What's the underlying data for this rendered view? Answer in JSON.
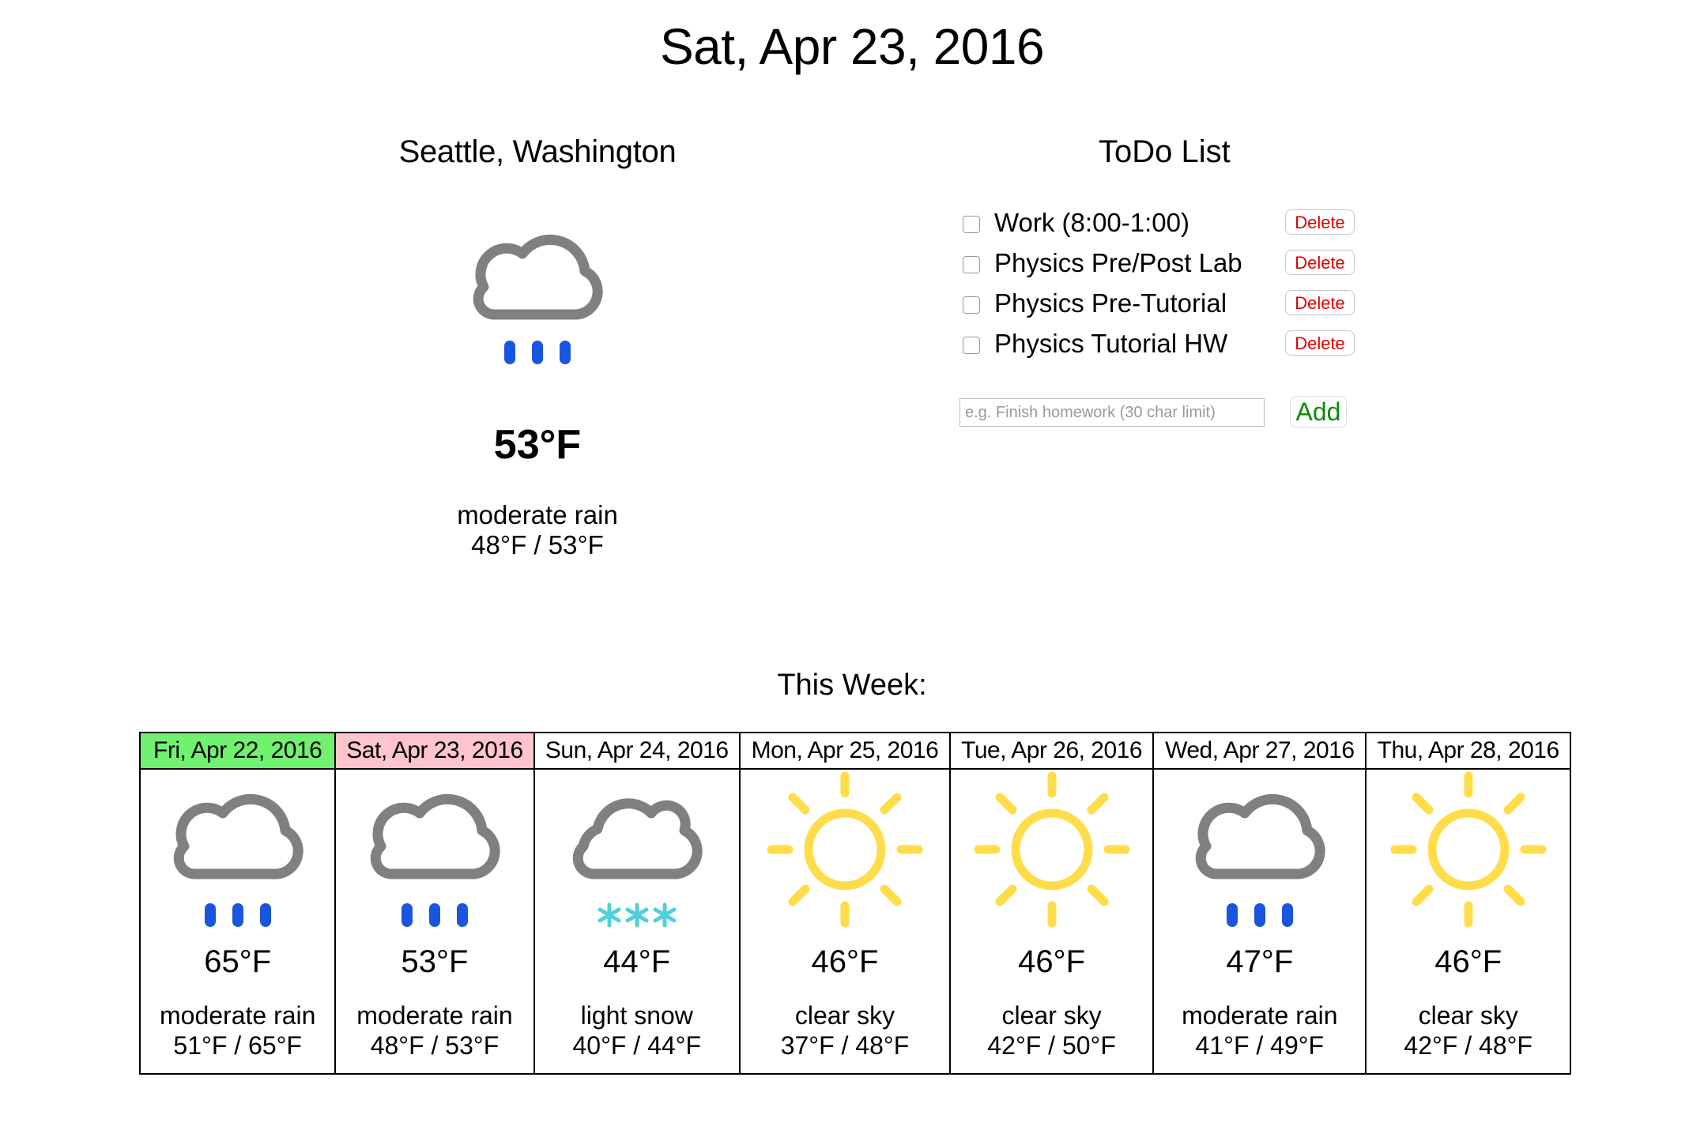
{
  "header": {
    "date": "Sat, Apr 23, 2016"
  },
  "current": {
    "city": "Seattle, Washington",
    "icon": "rain-cloud-icon",
    "temp": "53°F",
    "description": "moderate rain",
    "range": "48°F / 53°F"
  },
  "todo": {
    "title": "ToDo List",
    "items": [
      {
        "label": "Work (8:00-1:00)",
        "checked": false,
        "delete_label": "Delete"
      },
      {
        "label": "Physics Pre/Post Lab",
        "checked": false,
        "delete_label": "Delete"
      },
      {
        "label": "Physics Pre-Tutorial",
        "checked": false,
        "delete_label": "Delete"
      },
      {
        "label": "Physics Tutorial HW",
        "checked": false,
        "delete_label": "Delete"
      }
    ],
    "input_placeholder": "e.g. Finish homework (30 char limit)",
    "add_label": "Add"
  },
  "week": {
    "title": "This Week:",
    "days": [
      {
        "date": "Fri, Apr 22, 2016",
        "icon": "rain-cloud-icon",
        "temp": "65°F",
        "description": "moderate rain",
        "range": "51°F / 65°F",
        "highlight": "yesterday"
      },
      {
        "date": "Sat, Apr 23, 2016",
        "icon": "rain-cloud-icon",
        "temp": "53°F",
        "description": "moderate rain",
        "range": "48°F / 53°F",
        "highlight": "today"
      },
      {
        "date": "Sun, Apr 24, 2016",
        "icon": "snow-cloud-icon",
        "temp": "44°F",
        "description": "light snow",
        "range": "40°F / 44°F",
        "highlight": ""
      },
      {
        "date": "Mon, Apr 25, 2016",
        "icon": "sun-icon",
        "temp": "46°F",
        "description": "clear sky",
        "range": "37°F / 48°F",
        "highlight": ""
      },
      {
        "date": "Tue, Apr 26, 2016",
        "icon": "sun-icon",
        "temp": "46°F",
        "description": "clear sky",
        "range": "42°F / 50°F",
        "highlight": ""
      },
      {
        "date": "Wed, Apr 27, 2016",
        "icon": "rain-cloud-icon",
        "temp": "47°F",
        "description": "moderate rain",
        "range": "41°F / 49°F",
        "highlight": ""
      },
      {
        "date": "Thu, Apr 28, 2016",
        "icon": "sun-icon",
        "temp": "46°F",
        "description": "clear sky",
        "range": "42°F / 48°F",
        "highlight": ""
      }
    ]
  },
  "colors": {
    "cloud": "#808080",
    "rain": "#1a55e0",
    "snow": "#4fd0dc",
    "sun": "#ffdd4a",
    "delete_text": "#e00000",
    "add_text": "#0a8a0a",
    "yesterday_bg": "#70f270",
    "today_bg": "#ffc4cc"
  }
}
